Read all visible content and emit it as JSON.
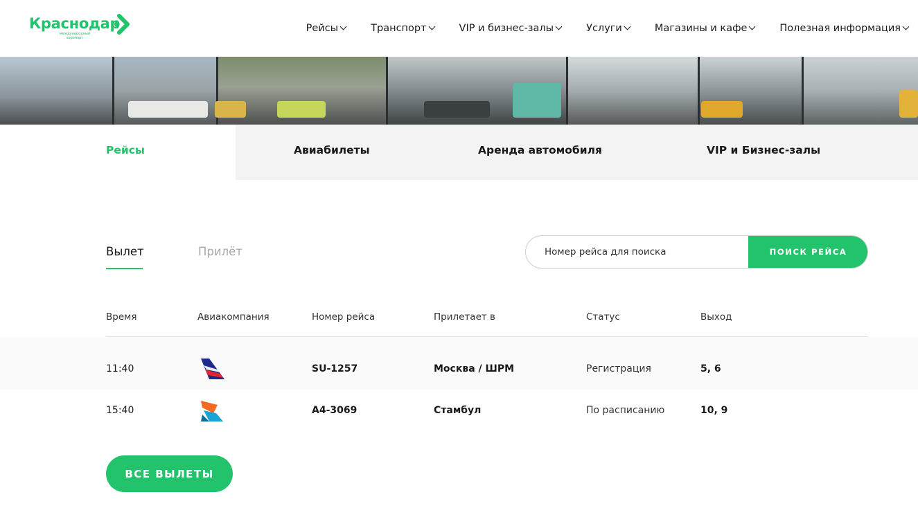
{
  "logo": {
    "name": "Краснодар",
    "subtitle_line1": "международный",
    "subtitle_line2": "аэропорт"
  },
  "nav": {
    "items": [
      {
        "label": "Рейсы"
      },
      {
        "label": "Транспорт"
      },
      {
        "label": "VIP и бизнес-залы"
      },
      {
        "label": "Услуги"
      },
      {
        "label": "Магазины и кафе"
      },
      {
        "label": "Полезная информация"
      }
    ]
  },
  "tabs": [
    {
      "label": "Рейсы",
      "active": true
    },
    {
      "label": "Авиабилеты",
      "active": false
    },
    {
      "label": "Аренда автомобиля",
      "active": false
    },
    {
      "label": "VIP и Бизнес-залы",
      "active": false
    }
  ],
  "subtabs": {
    "departures": "Вылет",
    "arrivals": "Прилёт",
    "active": "departures"
  },
  "search": {
    "placeholder": "Номер рейса для поиска",
    "value": "",
    "button_label": "ПОИСК РЕЙСА"
  },
  "table": {
    "headers": {
      "time": "Время",
      "airline": "Авиакомпания",
      "flight": "Номер рейса",
      "destination": "Прилетает в",
      "status": "Статус",
      "gate": "Выход"
    },
    "rows": [
      {
        "time": "11:40",
        "airline_logo": "aeroflot-logo",
        "flight": "SU-1257",
        "destination": "Москва / ШРМ",
        "status": "Регистрация",
        "gate": "5, 6"
      },
      {
        "time": "15:40",
        "airline_logo": "azimuth-logo",
        "flight": "A4-3069",
        "destination": "Стамбул",
        "status": "По расписанию",
        "gate": "10, 9"
      }
    ]
  },
  "all_departures_button": "ВСЕ ВЫЛЕТЫ",
  "colors": {
    "accent": "#22c36a",
    "text": "#1a1a1a",
    "muted": "#a9a9a9",
    "tab_bar_bg": "#f3f3f3"
  }
}
